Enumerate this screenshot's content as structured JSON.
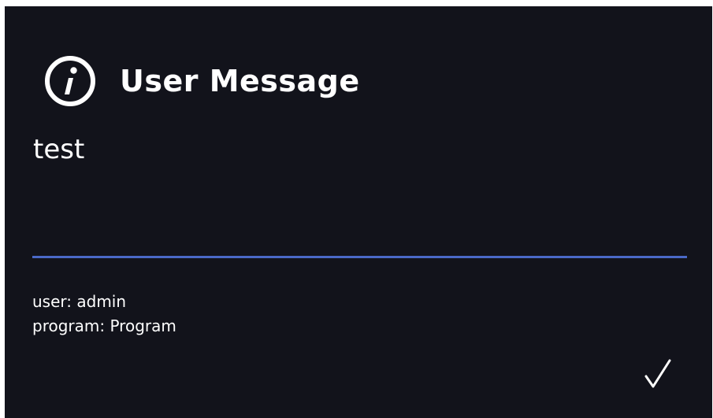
{
  "dialog": {
    "title": "User Message",
    "icon": "info-icon",
    "message": "test",
    "details": {
      "user_line": "user: admin",
      "program_line": "program: Program"
    },
    "confirm_icon": "checkmark-icon"
  },
  "colors": {
    "background": "#12131b",
    "text": "#ffffff",
    "divider": "#4a69c7"
  }
}
